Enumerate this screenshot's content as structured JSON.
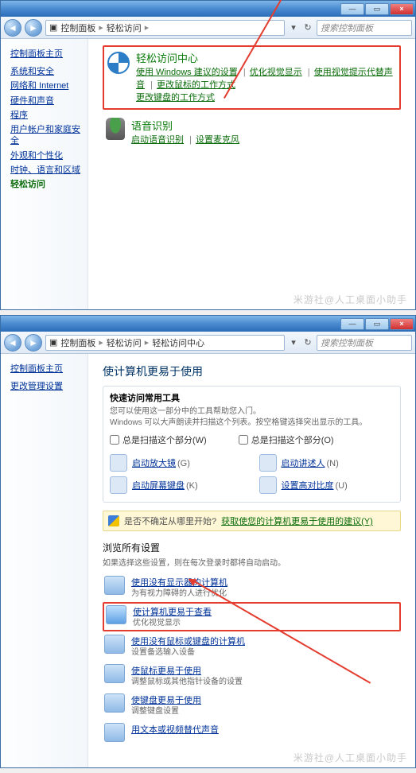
{
  "watermark": "米游社@人工桌面小助手",
  "win1": {
    "breadcrumb": {
      "a": "控制面板",
      "b": "轻松访问"
    },
    "search_placeholder": "搜索控制面板",
    "sidebar": {
      "home": "控制面板主页",
      "items": [
        "系统和安全",
        "网络和 Internet",
        "硬件和声音",
        "程序",
        "用户帐户和家庭安全",
        "外观和个性化",
        "时钟、语言和区域",
        "轻松访问"
      ]
    },
    "ease": {
      "title": "轻松访问中心",
      "links": [
        "使用 Windows 建议的设置",
        "优化视觉显示",
        "使用视觉提示代替声音",
        "更改鼠标的工作方式",
        "更改键盘的工作方式"
      ]
    },
    "voice": {
      "title": "语音识别",
      "links": [
        "启动语音识别",
        "设置麦克风"
      ]
    }
  },
  "win2": {
    "breadcrumb": {
      "a": "控制面板",
      "b": "轻松访问",
      "c": "轻松访问中心"
    },
    "search_placeholder": "搜索控制面板",
    "sidebar": {
      "home": "控制面板主页",
      "items": [
        "更改管理设置"
      ]
    },
    "page_title": "使计算机更易于使用",
    "quick": {
      "heading": "快速访问常用工具",
      "line1": "您可以使用这一部分中的工具帮助您入门。",
      "line2": "Windows 可以大声朗读并扫描这个列表。按空格键选择突出显示的工具。",
      "chk1": "总是扫描这个部分(W)",
      "chk2": "总是扫描这个部分(O)"
    },
    "tools": [
      {
        "label": "启动放大镜",
        "key": "(G)"
      },
      {
        "label": "启动讲述人",
        "key": "(N)"
      },
      {
        "label": "启动屏幕键盘",
        "key": "(K)"
      },
      {
        "label": "设置高对比度",
        "key": "(U)"
      }
    ],
    "notify": {
      "text": "是否不确定从哪里开始?",
      "link": "获取使您的计算机更易于使用的建议(Y)"
    },
    "browse": {
      "head": "浏览所有设置",
      "sub": "如果选择这些设置，则在每次登录时都将自动启动。"
    },
    "options": [
      {
        "title": "使用没有显示器的计算机",
        "desc": "为有视力障碍的人进行优化"
      },
      {
        "title": "使计算机更易于查看",
        "desc": "优化视觉显示"
      },
      {
        "title": "使用没有鼠标或键盘的计算机",
        "desc": "设置备选输入设备"
      },
      {
        "title": "使鼠标更易于使用",
        "desc": "调整鼠标或其他指针设备的设置"
      },
      {
        "title": "使键盘更易于使用",
        "desc": "调整键盘设置"
      },
      {
        "title": "用文本或视频替代声音",
        "desc": ""
      }
    ]
  }
}
